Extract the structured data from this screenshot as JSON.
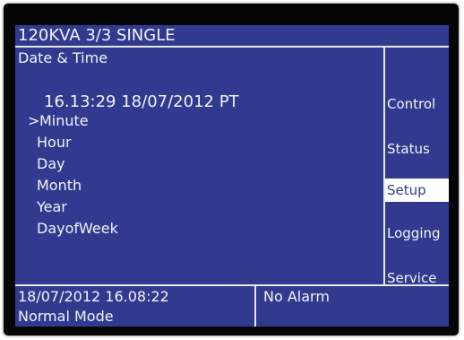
{
  "colors": {
    "screen_background": "#313a8e",
    "text": "#f2f3fa",
    "divider": "#e6e8f5",
    "bezel": "#050505",
    "selected_tab_background": "#ffffff"
  },
  "header": {
    "title": "120KVA   3/3 SINGLE"
  },
  "page": {
    "title": "Date & Time",
    "current_datetime": "16.13:29 18/07/2012 PT",
    "selection_marker": ">",
    "items": [
      {
        "label": "Minute",
        "selected": true
      },
      {
        "label": "Hour",
        "selected": false
      },
      {
        "label": "Day",
        "selected": false
      },
      {
        "label": "Month",
        "selected": false
      },
      {
        "label": "Year",
        "selected": false
      },
      {
        "label": "DayofWeek",
        "selected": false
      }
    ]
  },
  "sidebar": {
    "items": [
      {
        "label": "Control",
        "active": false
      },
      {
        "label": "Status",
        "active": false
      },
      {
        "label": "Setup",
        "active": true
      },
      {
        "label": "Logging",
        "active": false
      },
      {
        "label": "Service",
        "active": false
      }
    ]
  },
  "status_bar": {
    "datetime": "18/07/2012  16.08:22",
    "mode": "Normal Mode",
    "alarm": "No Alarm"
  }
}
